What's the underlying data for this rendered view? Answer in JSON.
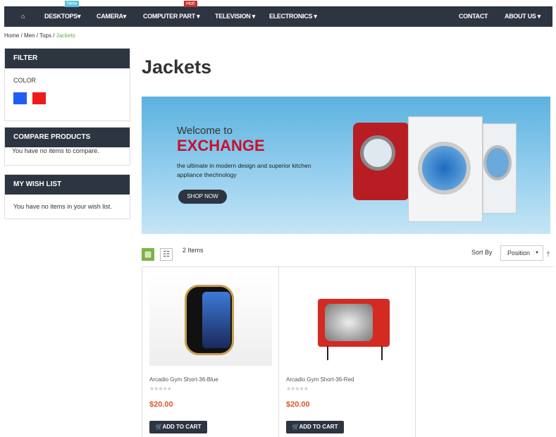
{
  "nav": {
    "home_icon": "home-icon",
    "items": [
      "DESKTOPS",
      "CAMERA",
      "COMPUTER PART",
      "TELEVISION",
      "ELECTRONICS"
    ],
    "right": [
      "CONTACT",
      "ABOUT US"
    ],
    "badge_new": "New",
    "badge_hot": "Hot!",
    "badge_new_color": "#5bc0de",
    "badge_hot_color": "#c9302c"
  },
  "breadcrumb": {
    "items": [
      "Home",
      "Men",
      "Tops"
    ],
    "current": "Jackets"
  },
  "filter": {
    "title": "FILTER",
    "color_label": "COLOR",
    "colors": [
      "#1f5ef0",
      "#ef1b1b"
    ]
  },
  "compare": {
    "title": "COMPARE PRODUCTS",
    "text": "You have no items to compare."
  },
  "wishlist": {
    "title": "MY WISH LIST",
    "text": "You have no items in your wish list."
  },
  "page_title": "Jackets",
  "banner": {
    "welcome": "Welcome to",
    "headline": "EXCHANGE",
    "text1": "the ultimate in modern design and superior kitchen",
    "text2": "appliance thechnology",
    "button": "SHOP NOW"
  },
  "toolbar": {
    "count": "2 Items",
    "sort_label": "Sort By",
    "sort_value": "Position"
  },
  "products": [
    {
      "name": "Arcadio Gym Short-36-Blue",
      "rating": 0,
      "price": "$20.00",
      "button": "ADD TO CART"
    },
    {
      "name": "Arcadio Gym Short-36-Red",
      "rating": 0,
      "price": "$20.00",
      "button": "ADD TO CART"
    }
  ]
}
